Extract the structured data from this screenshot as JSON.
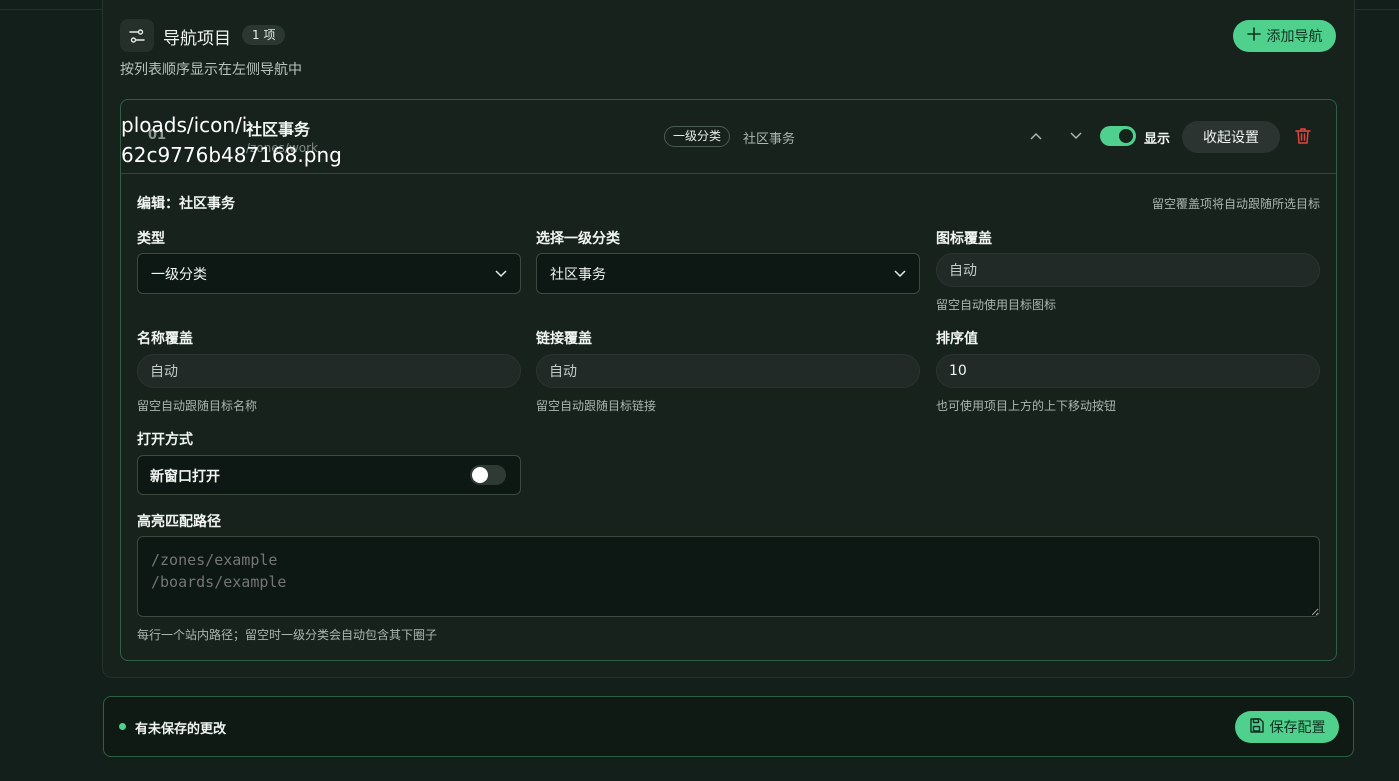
{
  "header": {
    "title": "导航项目",
    "count": "1 项",
    "subtitle": "按列表顺序显示在左侧导航中",
    "add_button": "添加导航"
  },
  "item": {
    "index": "01",
    "broken_image_text": "ploads/icon/i\n62c9776b487168.png",
    "name": "社区事务",
    "url": "/zones/work",
    "type_badge": "一级分类",
    "type_target": "社区事务",
    "show_label": "显示",
    "show_enabled": true,
    "collapse_button": "收起设置"
  },
  "editor": {
    "title": "编辑：社区事务",
    "hint": "留空覆盖项将自动跟随所选目标",
    "type": {
      "label": "类型",
      "value": "一级分类"
    },
    "category": {
      "label": "选择一级分类",
      "value": "社区事务"
    },
    "icon_override": {
      "label": "图标覆盖",
      "placeholder": "自动",
      "help": "留空自动使用目标图标"
    },
    "name_override": {
      "label": "名称覆盖",
      "placeholder": "自动",
      "help": "留空自动跟随目标名称"
    },
    "link_override": {
      "label": "链接覆盖",
      "placeholder": "自动",
      "help": "留空自动跟随目标链接"
    },
    "sort": {
      "label": "排序值",
      "value": "10",
      "help": "也可使用项目上方的上下移动按钮"
    },
    "open_mode": {
      "label": "打开方式",
      "option": "新窗口打开",
      "enabled": false
    },
    "highlight": {
      "label": "高亮匹配路径",
      "placeholder": "/zones/example\n/boards/example",
      "help": "每行一个站内路径；留空时一级分类会自动包含其下圈子"
    }
  },
  "footer": {
    "status": "有未保存的更改",
    "save_button": "保存配置"
  },
  "colors": {
    "accent": "#4fd08d",
    "danger": "#e0443e",
    "background": "#131f1a"
  }
}
